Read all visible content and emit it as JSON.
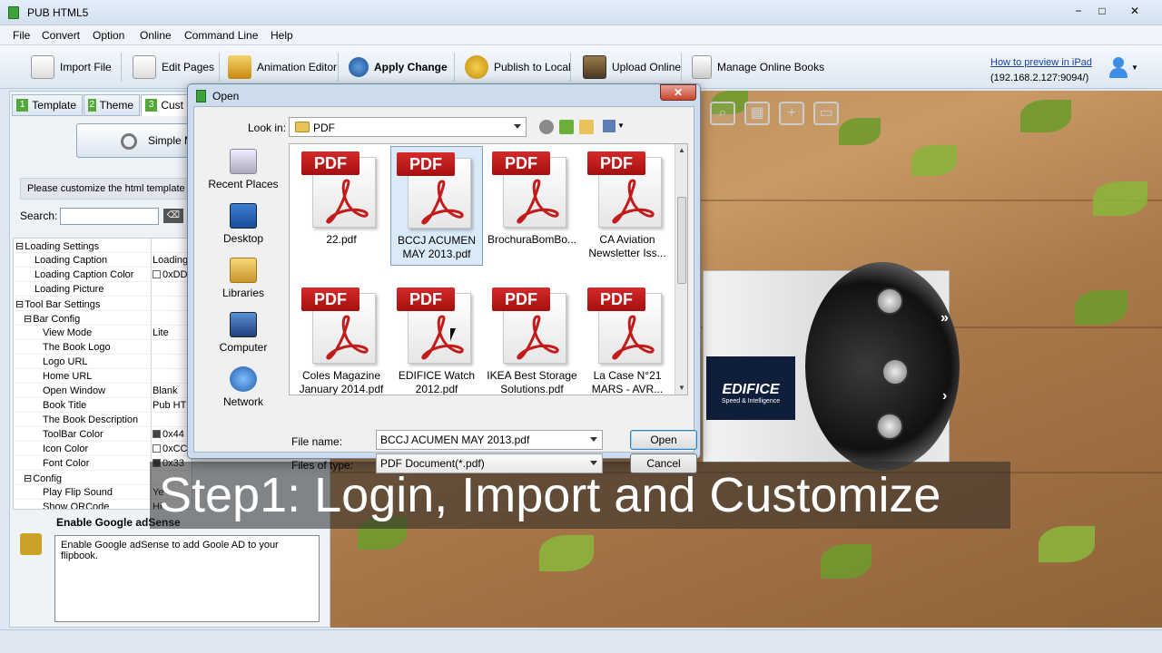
{
  "app": {
    "title": "PUB HTML5",
    "min_label": "−",
    "max_label": "□",
    "close_label": "✕"
  },
  "menu": [
    "File",
    "Convert",
    "Option",
    "Online",
    "Command Line",
    "Help"
  ],
  "toolbar": {
    "import_file": "Import File",
    "edit_pages": "Edit Pages",
    "animation_editor": "Animation Editor",
    "apply_change": "Apply Change",
    "publish_local": "Publish to Local",
    "upload_online": "Upload Online",
    "manage_online": "Manage Online Books"
  },
  "help": {
    "link": "How to preview in iPad",
    "address": "(192.168.2.127:9094/)"
  },
  "tabs": [
    {
      "num": "1",
      "label": "Template"
    },
    {
      "num": "2",
      "label": "Theme"
    },
    {
      "num": "3",
      "label": "Cust"
    }
  ],
  "left": {
    "simple_mode": "Simple M",
    "customize_hint": "Please customize the html template h",
    "search_label": "Search:",
    "search_value": "",
    "clear_label": "⌫"
  },
  "properties": [
    {
      "name": "Loading Settings",
      "value": "",
      "level": 0,
      "group": true
    },
    {
      "name": "Loading Caption",
      "value": "Loading",
      "level": 1
    },
    {
      "name": "Loading Caption Color",
      "value": "0xDD",
      "level": 1,
      "swatch": "#ffffff"
    },
    {
      "name": "Loading Picture",
      "value": "",
      "level": 1
    },
    {
      "name": "Tool Bar Settings",
      "value": "",
      "level": 0,
      "group": true
    },
    {
      "name": "Bar Config",
      "value": "",
      "level": 1,
      "group": true
    },
    {
      "name": "View Mode",
      "value": "Lite",
      "level": 2
    },
    {
      "name": "The Book Logo",
      "value": "",
      "level": 2
    },
    {
      "name": "Logo URL",
      "value": "",
      "level": 2
    },
    {
      "name": "Home URL",
      "value": "",
      "level": 2
    },
    {
      "name": "Open Window",
      "value": "Blank",
      "level": 2
    },
    {
      "name": "Book Title",
      "value": "Pub HTM",
      "level": 2
    },
    {
      "name": "The Book Description",
      "value": "",
      "level": 2
    },
    {
      "name": "ToolBar Color",
      "value": "0x44",
      "level": 2,
      "swatch": "#444444"
    },
    {
      "name": "Icon Color",
      "value": "0xCC",
      "level": 2,
      "swatch": "#ffffff"
    },
    {
      "name": "Font Color",
      "value": "0x33",
      "level": 2,
      "swatch": "#333333"
    },
    {
      "name": "Config",
      "value": "",
      "level": 1,
      "group": true
    },
    {
      "name": "Play Flip Sound",
      "value": "Ye",
      "level": 2
    },
    {
      "name": "Show QRCode",
      "value": "Hi",
      "level": 2
    }
  ],
  "adsense": {
    "title": "Enable Google adSense",
    "description": "Enable Google adSense to add Goole AD to your flipbook."
  },
  "dialog": {
    "title": "Open",
    "close_label": "✕",
    "lookin_label": "Look in:",
    "lookin_value": "PDF",
    "places": [
      "Recent Places",
      "Desktop",
      "Libraries",
      "Computer",
      "Network"
    ],
    "files": [
      {
        "line1": "22.pdf",
        "line2": "",
        "selected": false
      },
      {
        "line1": "BCCJ ACUMEN",
        "line2": "MAY 2013.pdf",
        "selected": true
      },
      {
        "line1": "BrochuraBomBo...",
        "line2": "",
        "selected": false
      },
      {
        "line1": "CA Aviation",
        "line2": "Newsletter Iss...",
        "selected": false
      },
      {
        "line1": "Coles Magazine",
        "line2": "January 2014.pdf",
        "selected": false
      },
      {
        "line1": "EDIFICE Watch",
        "line2": "2012.pdf",
        "selected": false
      },
      {
        "line1": "IKEA Best Storage",
        "line2": "Solutions.pdf",
        "selected": false
      },
      {
        "line1": "La Case N°21",
        "line2": "MARS - AVR...",
        "selected": false
      }
    ],
    "pdf_tag": "PDF",
    "filename_label": "File name:",
    "filename_value": "BCCJ ACUMEN MAY 2013.pdf",
    "filetype_label": "Files of type:",
    "filetype_value": "PDF Document(*.pdf)",
    "open_label": "Open",
    "cancel_label": "Cancel"
  },
  "preview": {
    "brand": "EDIFICE",
    "brand_tagline": "Speed & Intelligence"
  },
  "caption": "Step1: Login, Import and Customize"
}
